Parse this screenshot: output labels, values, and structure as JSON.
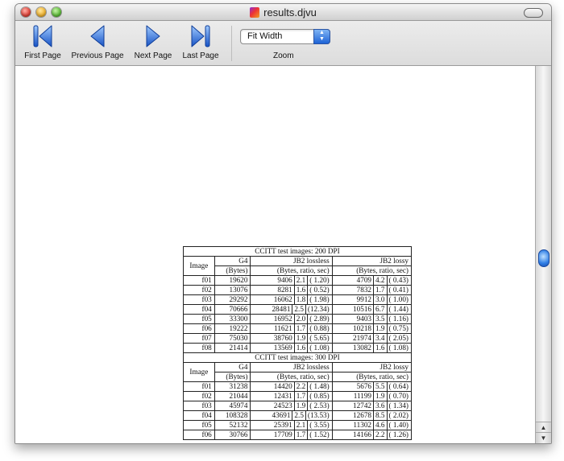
{
  "window": {
    "title": "results.djvu"
  },
  "toolbar": {
    "first_label": "First Page",
    "previous_label": "Previous Page",
    "next_label": "Next Page",
    "last_label": "Last Page",
    "zoom_value": "Fit Width",
    "zoom_label": "Zoom"
  },
  "colors": {
    "nav_icon": "#2a72e0",
    "scroll_thumb": "#2f7fe6"
  },
  "document": {
    "tables": [
      {
        "caption": "CCITT test images: 200 DPI",
        "headers": [
          "Image",
          "G4",
          "JB2 lossless",
          "JB2 lossy"
        ],
        "subheaders": [
          "(Bytes)",
          "(Bytes, ratio, sec)",
          "(Bytes, ratio, sec)"
        ],
        "rows": [
          {
            "image": "f01",
            "g4": "19620",
            "ll_bytes": "9406",
            "ll_ratio": "2.1",
            "ll_sec": "( 1.20)",
            "ly_bytes": "4709",
            "ly_ratio": "4.2",
            "ly_sec": "( 0.43)"
          },
          {
            "image": "f02",
            "g4": "13076",
            "ll_bytes": "8281",
            "ll_ratio": "1.6",
            "ll_sec": "( 0.52)",
            "ly_bytes": "7832",
            "ly_ratio": "1.7",
            "ly_sec": "( 0.41)"
          },
          {
            "image": "f03",
            "g4": "29292",
            "ll_bytes": "16062",
            "ll_ratio": "1.8",
            "ll_sec": "( 1.98)",
            "ly_bytes": "9912",
            "ly_ratio": "3.0",
            "ly_sec": "( 1.00)"
          },
          {
            "image": "f04",
            "g4": "70666",
            "ll_bytes": "28481",
            "ll_ratio": "2.5",
            "ll_sec": "(12.34)",
            "ly_bytes": "10516",
            "ly_ratio": "6.7",
            "ly_sec": "( 1.44)"
          },
          {
            "image": "f05",
            "g4": "33300",
            "ll_bytes": "16952",
            "ll_ratio": "2.0",
            "ll_sec": "( 2.89)",
            "ly_bytes": "9403",
            "ly_ratio": "3.5",
            "ly_sec": "( 1.16)"
          },
          {
            "image": "f06",
            "g4": "19222",
            "ll_bytes": "11621",
            "ll_ratio": "1.7",
            "ll_sec": "( 0.88)",
            "ly_bytes": "10218",
            "ly_ratio": "1.9",
            "ly_sec": "( 0.75)"
          },
          {
            "image": "f07",
            "g4": "75030",
            "ll_bytes": "38760",
            "ll_ratio": "1.9",
            "ll_sec": "( 5.65)",
            "ly_bytes": "21974",
            "ly_ratio": "3.4",
            "ly_sec": "( 2.05)"
          },
          {
            "image": "f08",
            "g4": "21414",
            "ll_bytes": "13569",
            "ll_ratio": "1.6",
            "ll_sec": "( 1.08)",
            "ly_bytes": "13082",
            "ly_ratio": "1.6",
            "ly_sec": "( 1.08)"
          }
        ]
      },
      {
        "caption": "CCITT test images: 300 DPI",
        "headers": [
          "Image",
          "G4",
          "JB2 lossless",
          "JB2 lossy"
        ],
        "subheaders": [
          "(Bytes)",
          "(Bytes, ratio, sec)",
          "(Bytes, ratio, sec)"
        ],
        "rows": [
          {
            "image": "f01",
            "g4": "31238",
            "ll_bytes": "14420",
            "ll_ratio": "2.2",
            "ll_sec": "( 1.48)",
            "ly_bytes": "5676",
            "ly_ratio": "5.5",
            "ly_sec": "( 0.64)"
          },
          {
            "image": "f02",
            "g4": "21044",
            "ll_bytes": "12431",
            "ll_ratio": "1.7",
            "ll_sec": "( 0.85)",
            "ly_bytes": "11199",
            "ly_ratio": "1.9",
            "ly_sec": "( 0.70)"
          },
          {
            "image": "f03",
            "g4": "45974",
            "ll_bytes": "24523",
            "ll_ratio": "1.9",
            "ll_sec": "( 2.53)",
            "ly_bytes": "12742",
            "ly_ratio": "3.6",
            "ly_sec": "( 1.34)"
          },
          {
            "image": "f04",
            "g4": "108328",
            "ll_bytes": "43691",
            "ll_ratio": "2.5",
            "ll_sec": "(13.53)",
            "ly_bytes": "12678",
            "ly_ratio": "8.5",
            "ly_sec": "( 2.02)"
          },
          {
            "image": "f05",
            "g4": "52132",
            "ll_bytes": "25391",
            "ll_ratio": "2.1",
            "ll_sec": "( 3.55)",
            "ly_bytes": "11302",
            "ly_ratio": "4.6",
            "ly_sec": "( 1.40)"
          },
          {
            "image": "f06",
            "g4": "30766",
            "ll_bytes": "17709",
            "ll_ratio": "1.7",
            "ll_sec": "( 1.52)",
            "ly_bytes": "14166",
            "ly_ratio": "2.2",
            "ly_sec": "( 1.26)"
          }
        ]
      }
    ]
  }
}
